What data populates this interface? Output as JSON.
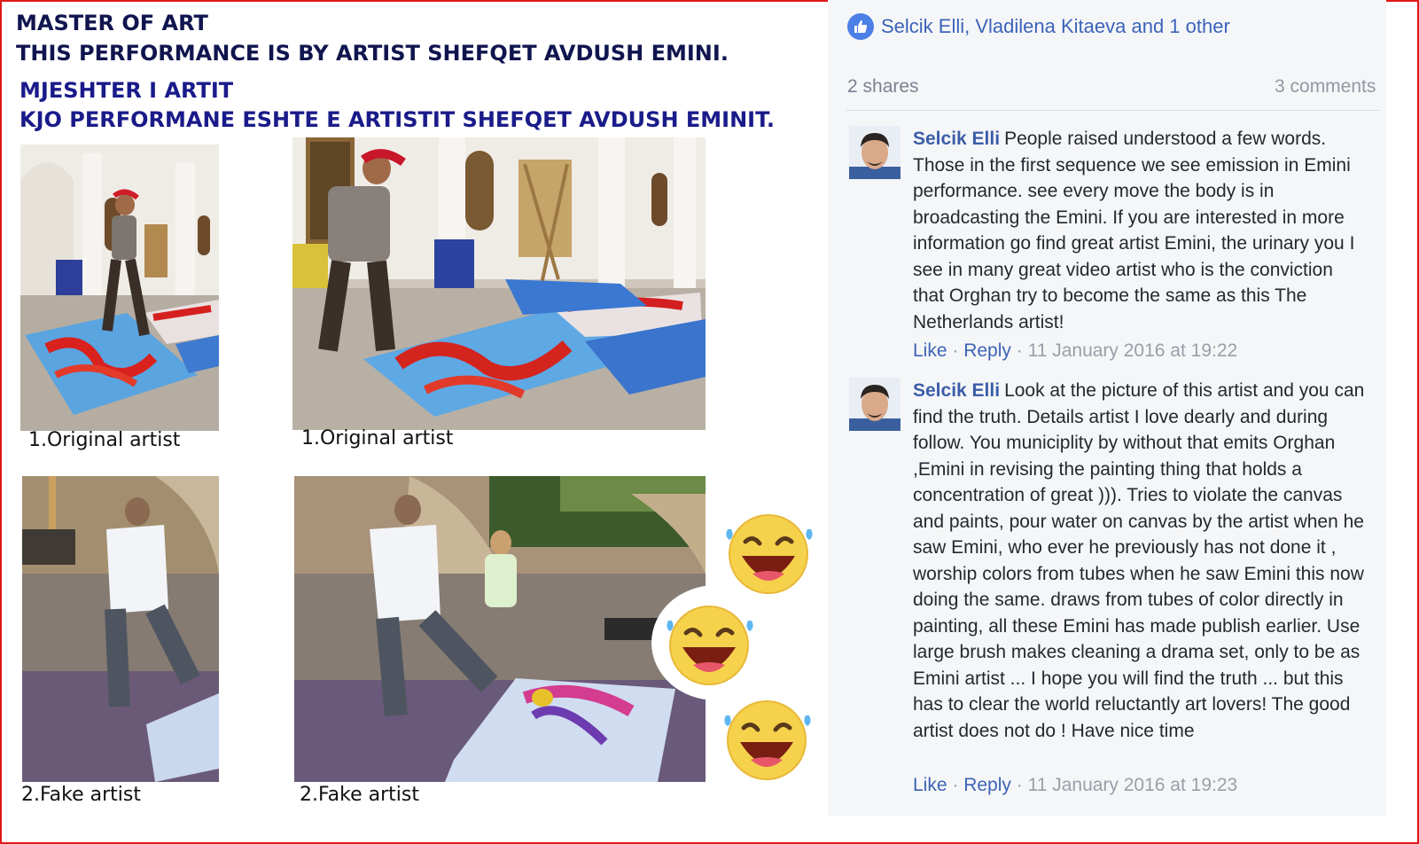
{
  "header": {
    "line1": "MASTER OF ART",
    "line2": "THIS PERFORMANCE IS BY ARTIST SHEFQET AVDUSH EMINI.",
    "line3": "MJESHTER I ARTIT",
    "line4": "KJO PERFORMANE ESHTE E ARTISTIT SHEFQET AVDUSH EMINIT."
  },
  "photos": [
    {
      "caption": "1.Original artist"
    },
    {
      "caption": "1.Original artist"
    },
    {
      "caption": "2.Fake artist"
    },
    {
      "caption": "2.Fake artist"
    }
  ],
  "emojis": [
    "laughing-face",
    "laughing-face",
    "laughing-face"
  ],
  "facebook": {
    "likes_text": "Selcik Elli, Vladilena Kitaeva and 1 other",
    "shares": "2 shares",
    "comments_count": "3 comments",
    "comments": [
      {
        "author": "Selcik Elli",
        "text": "People raised understood a few words. Those in the first sequence we see emission in Emini performance. see every move the body is in broadcasting the Emini. If you are interested in more information go find great artist Emini, the urinary you I see in many great video artist who is the conviction that Orghan try to become the same as this The Netherlands artist!",
        "like": "Like",
        "reply": "Reply",
        "timestamp": "11 January 2016 at 19:22"
      },
      {
        "author": "Selcik Elli",
        "text": "Look at the picture of this artist and you can find the truth. Details artist I love dearly and during follow. You municiplity by without that emits Orghan ,Emini in revising the painting thing that holds a concentration of great ))). Tries to violate the canvas and paints, pour water on canvas by the artist when he saw Emini, who ever he previously has not done it , worship colors from tubes when he saw Emini this now doing the same. draws from tubes of color directly in painting, all these Emini has made publish earlier. Use large brush makes cleaning a drama set, only to be as Emini artist ... I hope you will find the truth ... but this has to clear the world reluctantly art lovers! The good artist does not do ! Have nice time",
        "like": "Like",
        "reply": "Reply",
        "timestamp": "11 January 2016 at 19:23"
      }
    ]
  },
  "colors": {
    "frame": "#e01818",
    "header_dark": "#10154f",
    "header_blue": "#1a1b8a",
    "fb_link": "#3b5ea8",
    "fb_panel": "#f5f6f8"
  }
}
